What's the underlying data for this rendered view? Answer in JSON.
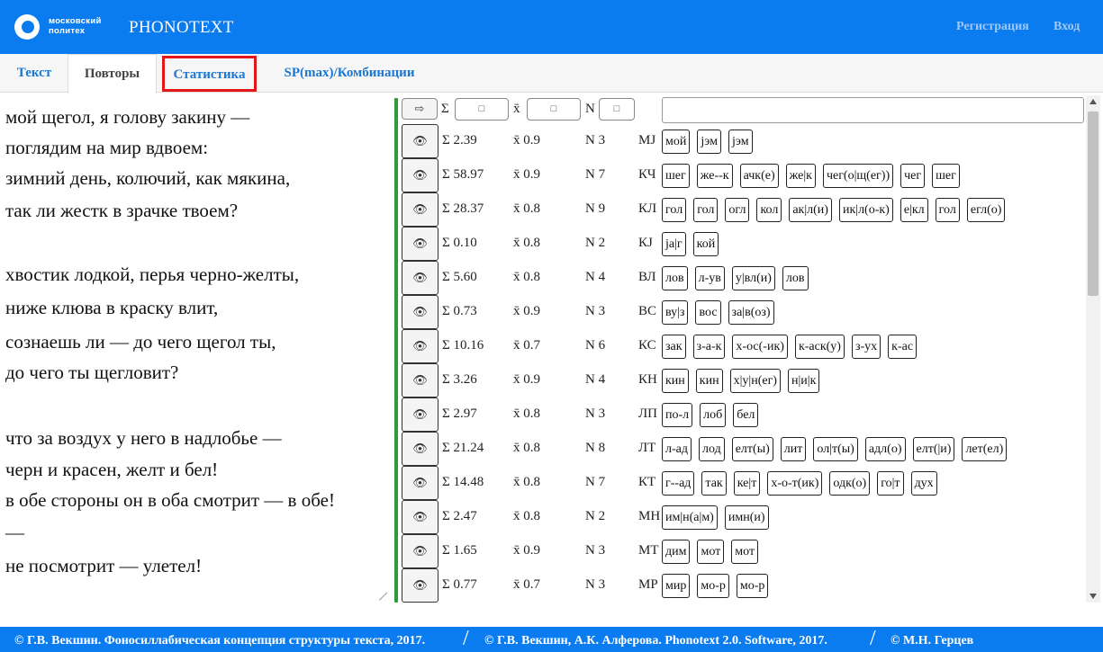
{
  "header": {
    "logo_line1": "московский",
    "logo_line2": "политех",
    "brand": "PHONOTEXT",
    "register": "Регистрация",
    "login": "Вход"
  },
  "tabs": {
    "text": "Текст",
    "repeats": "Повторы",
    "stats": "Статистика",
    "sp": "SP(max)/Комбинации"
  },
  "poem": [
    "мой щегол, я голову закину —",
    "поглядим на мир вдвоем:",
    "зимний день, колючий, как мякина,",
    "так ли жестк в зрачке твоем?",
    "",
    "хвостик лодкой, перья черно-желты,",
    "ниже клюва в краску влит,",
    "сознаешь ли — до чего щегол ты,",
    "до чего ты щегловит?",
    "",
    "что за воздух у него в надлобье —",
    "черн и красен, желт и бел!",
    "в обе стороны он в оба смотрит — в обе!",
    "—",
    "не посмотрит — улетел!"
  ],
  "filters": {
    "arrow": "⇨",
    "sum_label": "Σ",
    "mean_label": "x̄",
    "n_label": "N",
    "box": "□"
  },
  "rows": [
    {
      "sum": "Σ 2.39",
      "mean": "x̄ 0.9",
      "n": "N 3",
      "code": "MJ",
      "chips": [
        "мой",
        "jэм",
        "jэм"
      ]
    },
    {
      "sum": "Σ 58.97",
      "mean": "x̄ 0.9",
      "n": "N 7",
      "code": "КЧ",
      "chips": [
        "шег",
        "же--к",
        "ачк(е)",
        "же|к",
        "чег(о|щ(ег))",
        "чег",
        "шег"
      ]
    },
    {
      "sum": "Σ 28.37",
      "mean": "x̄ 0.8",
      "n": "N 9",
      "code": "КЛ",
      "chips": [
        "гол",
        "гол",
        "огл",
        "кол",
        "ак|л(и)",
        "ик|л(о-к)",
        "е|кл",
        "гол",
        "егл(о)"
      ]
    },
    {
      "sum": "Σ 0.10",
      "mean": "x̄ 0.8",
      "n": "N 2",
      "code": "КJ",
      "chips": [
        "ja|г",
        "кой"
      ]
    },
    {
      "sum": "Σ 5.60",
      "mean": "x̄ 0.8",
      "n": "N 4",
      "code": "ВЛ",
      "chips": [
        "лов",
        "л-ув",
        "у|вл(и)",
        "лов"
      ]
    },
    {
      "sum": "Σ 0.73",
      "mean": "x̄ 0.9",
      "n": "N 3",
      "code": "ВС",
      "chips": [
        "ву|з",
        "вос",
        "за|в(оз)"
      ]
    },
    {
      "sum": "Σ 10.16",
      "mean": "x̄ 0.7",
      "n": "N 6",
      "code": "КС",
      "chips": [
        "зак",
        "з-а-к",
        "х-ос(-ик)",
        "к-аск(у)",
        "з-ух",
        "к-ас"
      ]
    },
    {
      "sum": "Σ 3.26",
      "mean": "x̄ 0.9",
      "n": "N 4",
      "code": "КН",
      "chips": [
        "кин",
        "кин",
        "х|у|н(ег)",
        "н|и|к"
      ]
    },
    {
      "sum": "Σ 2.97",
      "mean": "x̄ 0.8",
      "n": "N 3",
      "code": "ЛП",
      "chips": [
        "по-л",
        "лоб",
        "бел"
      ]
    },
    {
      "sum": "Σ 21.24",
      "mean": "x̄ 0.8",
      "n": "N 8",
      "code": "ЛТ",
      "chips": [
        "л-ад",
        "лод",
        "елт(ы)",
        "лит",
        "ол|т(ы)",
        "адл(о)",
        "елт(|и)",
        "лет(ел)"
      ]
    },
    {
      "sum": "Σ 14.48",
      "mean": "x̄ 0.8",
      "n": "N 7",
      "code": "КТ",
      "chips": [
        "г--ад",
        "так",
        "ке|т",
        "х-о-т(ик)",
        "одк(о)",
        "го|т",
        "дух"
      ]
    },
    {
      "sum": "Σ 2.47",
      "mean": "x̄ 0.8",
      "n": "N 2",
      "code": "МН",
      "chips": [
        "им|н(а|м)",
        "имн(и)"
      ]
    },
    {
      "sum": "Σ 1.65",
      "mean": "x̄ 0.9",
      "n": "N 3",
      "code": "МТ",
      "chips": [
        "дим",
        "мот",
        "мот"
      ]
    },
    {
      "sum": "Σ 0.77",
      "mean": "x̄ 0.7",
      "n": "N 3",
      "code": "МР",
      "chips": [
        "мир",
        "мо-р",
        "мо-р"
      ]
    }
  ],
  "footer": {
    "item1": "© Г.В. Векшин. Фоносиллабическая концепция структуры текста, 2017.",
    "item2": "© Г.В. Векшин, А.К. Алферова. Phonotext 2.0. Software, 2017.",
    "item3": "© М.Н. Герцев",
    "sep": "/"
  }
}
